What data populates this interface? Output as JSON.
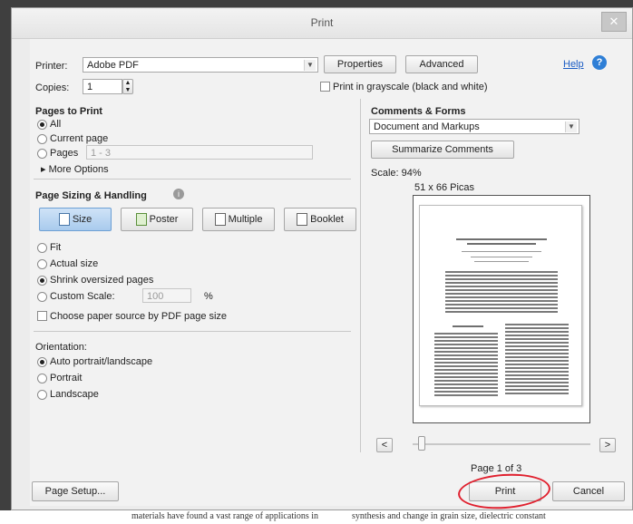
{
  "dialog": {
    "title": "Print",
    "close_glyph": "✕",
    "help_label": "Help",
    "help_icon": "help-icon"
  },
  "printer": {
    "label": "Printer:",
    "value": "Adobe PDF",
    "properties_label": "Properties",
    "advanced_label": "Advanced"
  },
  "copies": {
    "label": "Copies:",
    "value": "1"
  },
  "grayscale": {
    "label": "Print in grayscale (black and white)",
    "checked": false
  },
  "pages_to_print": {
    "heading": "Pages to Print",
    "all": "All",
    "current_page": "Current page",
    "pages": "Pages",
    "pages_value": "1 - 3",
    "more_options": "More Options",
    "selected": "All"
  },
  "sizing": {
    "heading": "Page Sizing & Handling",
    "buttons": [
      "Size",
      "Poster",
      "Multiple",
      "Booklet"
    ],
    "fit": "Fit",
    "actual_size": "Actual size",
    "shrink": "Shrink oversized pages",
    "custom_scale": "Custom Scale:",
    "custom_scale_value": "100",
    "percent": "%",
    "paper_source": "Choose paper source by PDF page size",
    "selected": "Shrink oversized pages"
  },
  "orientation": {
    "heading": "Orientation:",
    "auto": "Auto portrait/landscape",
    "portrait": "Portrait",
    "landscape": "Landscape",
    "selected": "Auto portrait/landscape"
  },
  "comments": {
    "heading": "Comments & Forms",
    "value": "Document and Markups",
    "summarize_label": "Summarize Comments"
  },
  "preview": {
    "scale": "Scale: 94%",
    "size": "51 x 66 Picas",
    "page_indicator": "Page 1 of 3",
    "prev_glyph": "<",
    "next_glyph": ">"
  },
  "footer": {
    "page_setup_label": "Page Setup...",
    "print_label": "Print",
    "cancel_label": "Cancel",
    "annotation_color": "#e0212f"
  },
  "background_doc": {
    "left_text": "materials have found a vast range of applications in",
    "right_text": "synthesis and change in grain size, dielectric constant"
  }
}
